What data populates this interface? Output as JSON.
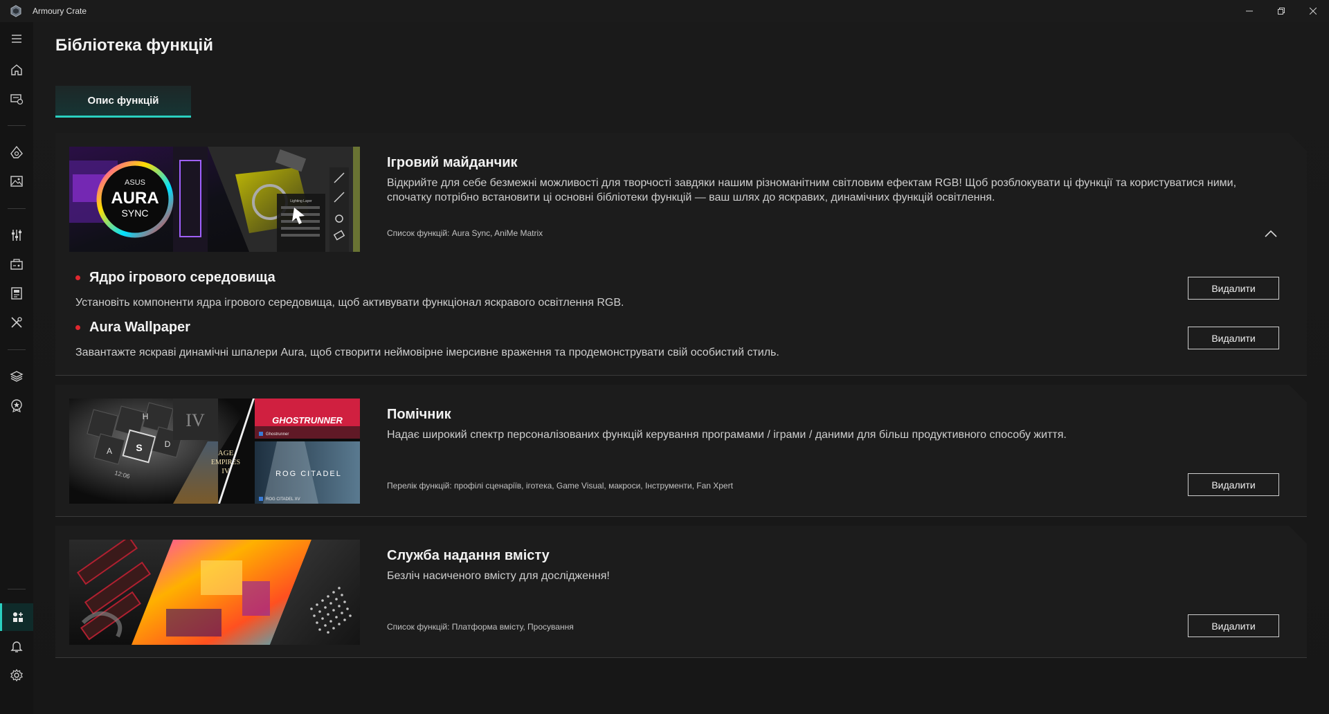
{
  "window": {
    "title": "Armoury Crate"
  },
  "page": {
    "title": "Бібліотека функцій",
    "tab": "Опис функцій"
  },
  "cards": [
    {
      "title": "Ігровий майданчик",
      "description": "Відкрийте для себе безмежні можливості для творчості завдяки нашим різноманітним світловим ефектам RGB! Щоб розблокувати ці функції та користуватися ними, спочатку потрібно встановити ці основні бібліотеки функцій — ваш шлях до яскравих, динамічних функцій освітлення.",
      "features": "Список функцій: Aura Sync, AniMe Matrix",
      "image_text": {
        "brand": "ASUS",
        "line1": "AURA",
        "line2": "SYNC",
        "panel": "Lighting Layer"
      },
      "items": [
        {
          "title": "Ядро ігрового середовища",
          "description": "Установіть компоненти ядра ігрового середовища, щоб активувати функціонал яскравого освітлення RGB.",
          "button": "Видалити"
        },
        {
          "title": "Aura Wallpaper",
          "description": "Завантажте яскраві динамічні шпалери Aura, щоб створити неймовірне імерсивне враження та продемонструвати свій особистий стиль.",
          "button": "Видалити"
        }
      ]
    },
    {
      "title": "Помічник",
      "description": "Надає широкий спектр персоналізованих функцій керування програмами / іграми / даними для більш продуктивного способу життя.",
      "features": "Перелік функцій: профілі сценаріїв, іготека, Game Visual, макроси, Інструменти, Fan Xpert",
      "button": "Видалити",
      "image_text": {
        "game1": "GHOSTRUNNER",
        "game1_caption": "Ghostrunner",
        "game2_line1": "AGE",
        "game2_line2": "EMPIRES",
        "game2_line3": "IV",
        "game3": "ROG CITADEL",
        "game3_caption": "ROG CITADEL XV",
        "roman": "IV",
        "keys": [
          "H",
          "A",
          "S",
          "D"
        ],
        "time": "12:06"
      }
    },
    {
      "title": "Служба надання вмісту",
      "description": "Безліч насиченого вмісту для дослідження!",
      "features": "Список функцій: Платформа вмісту, Просування",
      "button": "Видалити"
    }
  ],
  "sidebar": {
    "icons": [
      "menu-icon",
      "home-icon",
      "device-icon",
      "aura-icon",
      "wallpaper-icon",
      "sliders-icon",
      "game-library-icon",
      "game-visual-icon",
      "tools-icon",
      "layers-icon",
      "badge-icon",
      "feature-library-icon",
      "notification-icon",
      "settings-icon"
    ]
  },
  "colors": {
    "accent": "#2ad0c0",
    "bullet": "#e0282f",
    "background": "#1a1a1a"
  }
}
